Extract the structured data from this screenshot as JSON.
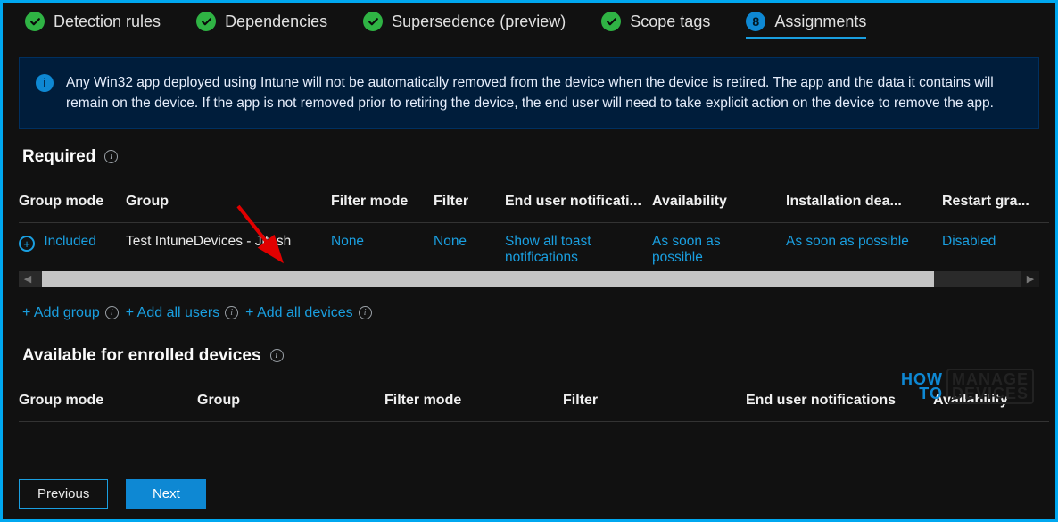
{
  "tabs": {
    "t1": "Detection rules",
    "t2": "Dependencies",
    "t3": "Supersedence (preview)",
    "t4": "Scope tags",
    "active_num": "8",
    "active_label": "Assignments"
  },
  "notice": {
    "text": "Any Win32 app deployed using Intune will not be automatically removed from the device when the device is retired. The app and the data it contains will remain on the device. If the app is not removed prior to retiring the device, the end user will need to take explicit action on the device to remove the app."
  },
  "sections": {
    "required_title": "Required",
    "available_title": "Available for enrolled devices"
  },
  "required": {
    "headers": {
      "group_mode": "Group mode",
      "group": "Group",
      "filter_mode": "Filter mode",
      "filter": "Filter",
      "end_user_notif": "End user notificati...",
      "availability": "Availability",
      "install_deadline": "Installation dea...",
      "restart_grace": "Restart gra..."
    },
    "row": {
      "mode": "Included",
      "group": "Test IntuneDevices - Jitesh",
      "filter_mode": "None",
      "filter": "None",
      "notif1": "Show all toast",
      "notif2": "notifications",
      "avail1": "As soon as",
      "avail2": "possible",
      "deadline": "As soon as possible",
      "restart": "Disabled"
    }
  },
  "add_links": {
    "add_group": "+ Add group",
    "add_users": "+ Add all users",
    "add_devices": "+ Add all devices"
  },
  "available": {
    "headers": {
      "group_mode": "Group mode",
      "group": "Group",
      "filter_mode": "Filter mode",
      "filter": "Filter",
      "end_user_notif": "End user notifications",
      "availability": "Availability"
    }
  },
  "footer": {
    "previous": "Previous",
    "next": "Next"
  },
  "watermark": {
    "l1a": "HOW",
    "l1b": "TO",
    "l2a": "MANAGE",
    "l2b": "DEVICES"
  }
}
